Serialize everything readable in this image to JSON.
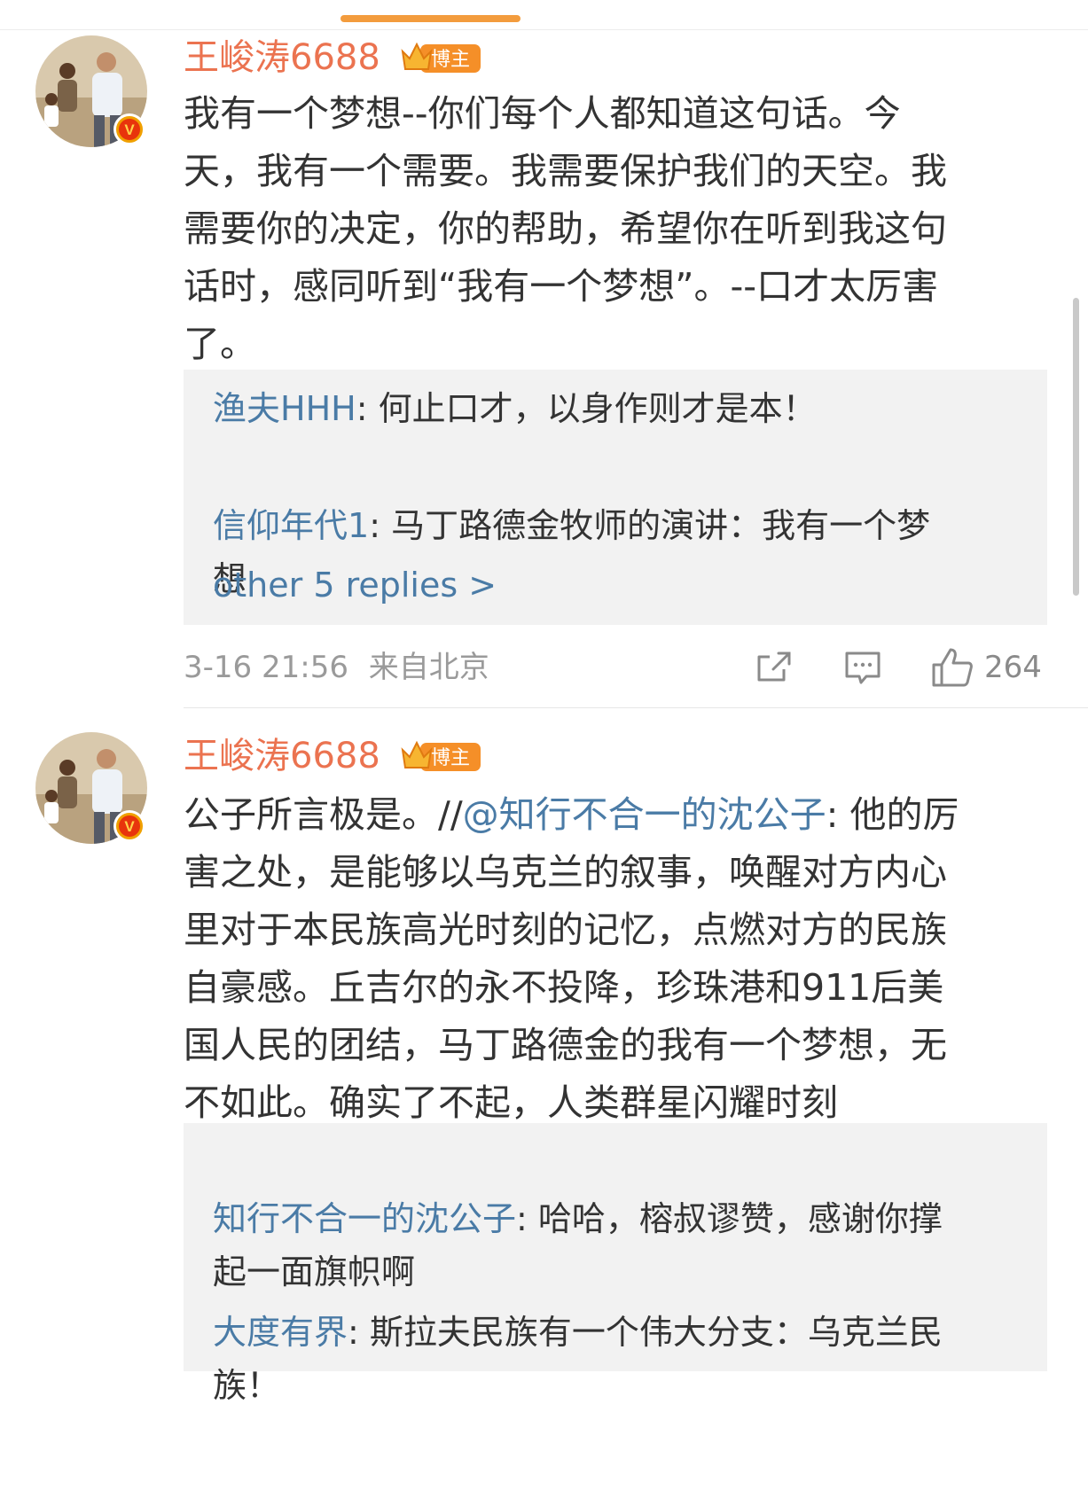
{
  "colors": {
    "username": "#eb7350",
    "link": "#4a7ba6",
    "text": "#333333",
    "meta": "#9a9a9a",
    "reply_bg": "#f2f2f2",
    "tab_indicator": "#f39c3d",
    "badge": "#f58f28"
  },
  "comments": [
    {
      "username": "王峻涛6688",
      "badge_label": "博主",
      "avatar_icon": "user-avatar-photo",
      "verified_icon": "verified-v-icon",
      "text": "我有一个梦想--你们每个人都知道这句话。今\n天，我有一个需要。我需要保护我们的天空。我\n需要你的决定，你的帮助，希望你在听到我这句\n话时，感同听到“我有一个梦想”。--口才太厉害\n了。",
      "replies": [
        {
          "name": "渔夫HHH",
          "sep": ": ",
          "text": "何止口才，以身作则才是本！"
        },
        {
          "name": "信仰年代1",
          "sep": ": ",
          "text": "马丁路德金牧师的演讲：我有一个梦\n想"
        }
      ],
      "more_replies": "other 5 replies >",
      "time": "3-16 21:56",
      "location": "来自北京",
      "like_count": "264",
      "icons": [
        "share-icon",
        "comment-icon",
        "like-icon"
      ]
    },
    {
      "username": "王峻涛6688",
      "badge_label": "博主",
      "avatar_icon": "user-avatar-photo",
      "verified_icon": "verified-v-icon",
      "text_prefix": "公子所言极是。//",
      "mention": "@知行不合一的沈公子",
      "text_suffix": ": 他的厉\n害之处，是能够以乌克兰的叙事，唤醒对方内心\n里对于本民族高光时刻的记忆，点燃对方的民族\n自豪感。丘吉尔的永不投降，珍珠港和911后美\n国人民的团结，马丁路德金的我有一个梦想，无\n不如此。确实了不起，人类群星闪耀时刻",
      "replies": [
        {
          "name": "知行不合一的沈公子",
          "sep": ": ",
          "text": "哈哈，榕叔谬赞，感谢你撑\n起一面旗帜啊"
        },
        {
          "name": "大度有界",
          "sep": ": ",
          "text": "斯拉夫民族有一个伟大分支：乌克兰民\n族！"
        }
      ]
    }
  ]
}
